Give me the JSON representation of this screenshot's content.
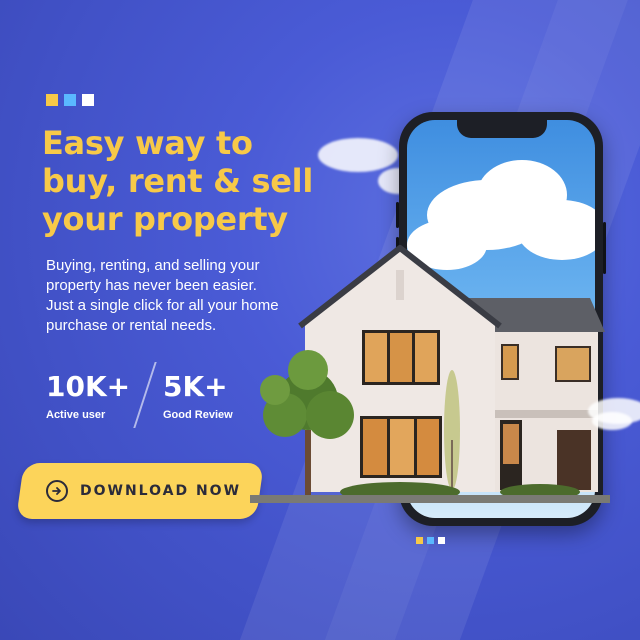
{
  "colors": {
    "accent_yellow": "#f7c948",
    "button_yellow": "#fcd45a",
    "background_blue": "#4a5bd6",
    "dot_colors": [
      "#f7c948",
      "#5ab8ff",
      "#ffffff"
    ]
  },
  "headline": {
    "line1": "Easy way to",
    "line2": "buy, rent & sell",
    "line3": "your property"
  },
  "description": {
    "line1": "Buying, renting, and selling your",
    "line2": "property has never been easier.",
    "line3": "Just a single click for all your home",
    "line4": "purchase or rental needs."
  },
  "stats": [
    {
      "value": "10K+",
      "label": "Active user"
    },
    {
      "value": "5K+",
      "label": "Good Review"
    }
  ],
  "cta": {
    "label": "DOWNLOAD NOW",
    "icon": "arrow-right-circle-icon"
  },
  "decor": {
    "phone_icon": "smartphone",
    "house_icon": "house-illustration"
  }
}
